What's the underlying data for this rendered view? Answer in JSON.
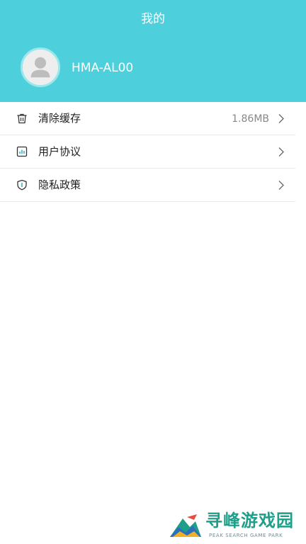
{
  "header": {
    "title": "我的",
    "username": "HMA-AL00",
    "background_color": "#4ed0dc"
  },
  "menu": {
    "items": [
      {
        "label": "清除缓存",
        "value": "1.86MB",
        "icon": "trash-icon"
      },
      {
        "label": "用户协议",
        "value": "",
        "icon": "document-chart-icon"
      },
      {
        "label": "隐私政策",
        "value": "",
        "icon": "shield-icon"
      }
    ]
  },
  "watermark": {
    "title": "寻峰游戏园",
    "subtitle": "PEAK SEARCH GAME PARK"
  }
}
